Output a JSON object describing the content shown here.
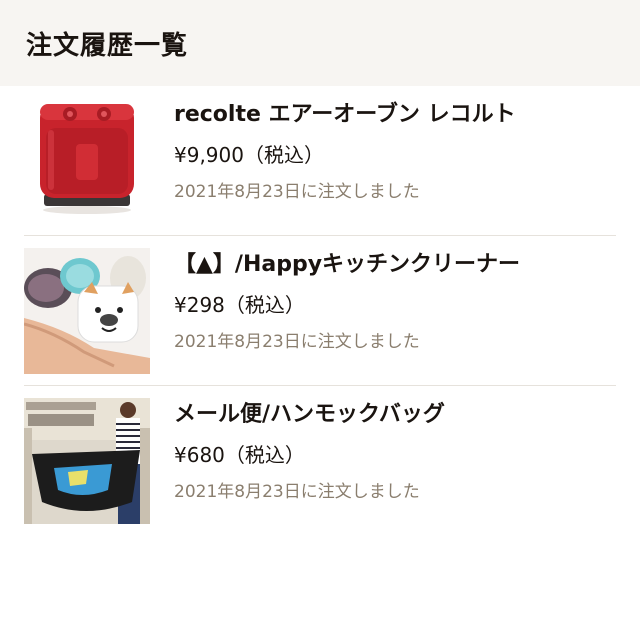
{
  "header": {
    "title": "注文履歴一覧"
  },
  "orders": [
    {
      "name": "recolte エアーオーブン レコルト",
      "price": "¥9,900（税込）",
      "date": "2021年8月23日に注文しました",
      "image_icon": "air-oven-image"
    },
    {
      "name": "【▲】/Happyキッチンクリーナー",
      "price": "¥298（税込）",
      "date": "2021年8月23日に注文しました",
      "image_icon": "kitchen-cleaner-image"
    },
    {
      "name": "メール便/ハンモックバッグ",
      "price": "¥680（税込）",
      "date": "2021年8月23日に注文しました",
      "image_icon": "hammock-bag-image"
    }
  ],
  "colors": {
    "header_bg": "#f7f5f2",
    "date_text": "#8a7e6e",
    "divider": "#e6e2dc",
    "oven_red": "#c8232c"
  }
}
